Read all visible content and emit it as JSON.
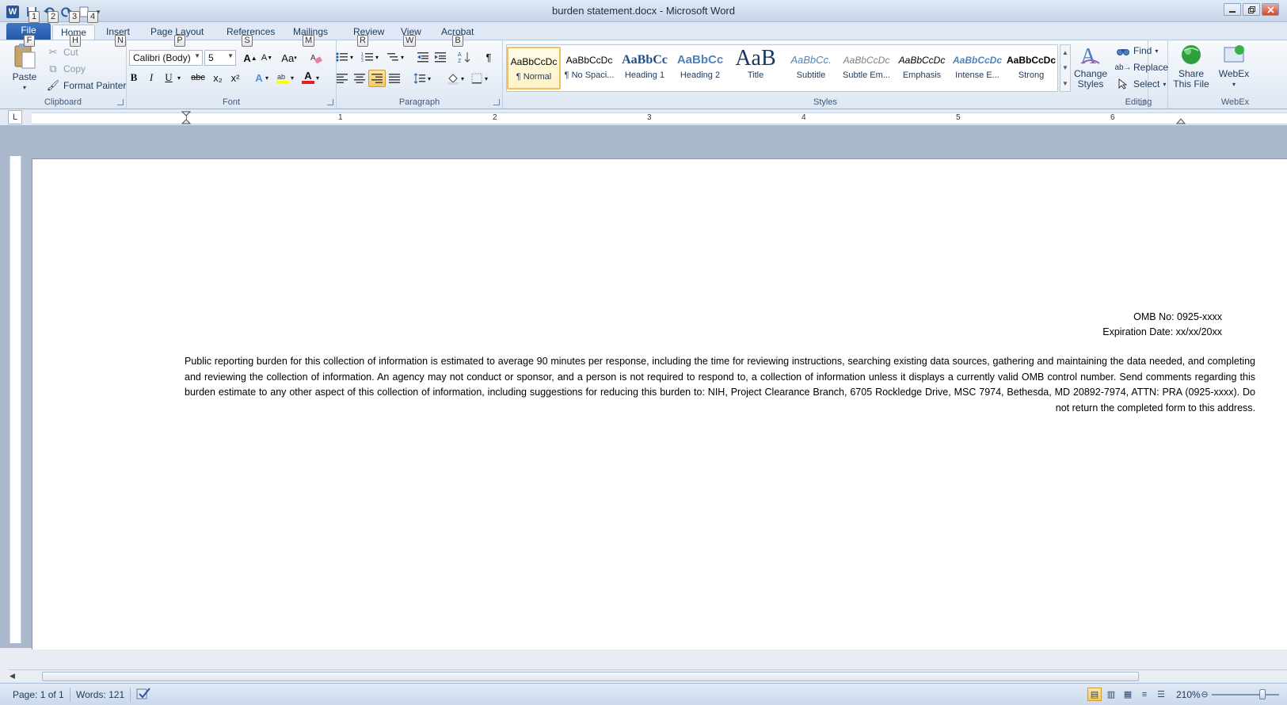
{
  "window": {
    "title": "burden statement.docx - Microsoft Word",
    "qat_keytips": [
      "1",
      "2",
      "3",
      "4"
    ]
  },
  "tabs": [
    {
      "label": "File",
      "keytip": "F"
    },
    {
      "label": "Home",
      "keytip": "H"
    },
    {
      "label": "Insert",
      "keytip": "N"
    },
    {
      "label": "Page Layout",
      "keytip": "P"
    },
    {
      "label": "References",
      "keytip": "S"
    },
    {
      "label": "Mailings",
      "keytip": "M"
    },
    {
      "label": "Review",
      "keytip": "R"
    },
    {
      "label": "View",
      "keytip": "W"
    },
    {
      "label": "Acrobat",
      "keytip": "B"
    }
  ],
  "clipboard": {
    "paste": "Paste",
    "cut": "Cut",
    "copy": "Copy",
    "format_painter": "Format Painter",
    "label": "Clipboard"
  },
  "font": {
    "name": "Calibri (Body)",
    "size": "5",
    "change_case": "Aa",
    "bold": "B",
    "italic": "I",
    "underline": "U",
    "strike": "abc",
    "subscript": "x₂",
    "superscript": "x²",
    "font_color": "A",
    "label": "Font"
  },
  "paragraph": {
    "pilcrow": "¶",
    "label": "Paragraph"
  },
  "styles": {
    "items": [
      {
        "preview": "AaBbCcDc",
        "name": "¶ Normal"
      },
      {
        "preview": "AaBbCcDc",
        "name": "¶ No Spaci..."
      },
      {
        "preview": "AaBbCc",
        "name": "Heading 1"
      },
      {
        "preview": "AaBbCc",
        "name": "Heading 2"
      },
      {
        "preview": "AaB",
        "name": "Title"
      },
      {
        "preview": "AaBbCc.",
        "name": "Subtitle"
      },
      {
        "preview": "AaBbCcDc",
        "name": "Subtle Em..."
      },
      {
        "preview": "AaBbCcDc",
        "name": "Emphasis"
      },
      {
        "preview": "AaBbCcDc",
        "name": "Intense E..."
      },
      {
        "preview": "AaBbCcDc",
        "name": "Strong"
      }
    ],
    "change_styles_line1": "Change",
    "change_styles_line2": "Styles",
    "label": "Styles"
  },
  "editing": {
    "find": "Find",
    "replace": "Replace",
    "select": "Select",
    "label": "Editing"
  },
  "webex": {
    "share_line1": "Share",
    "share_line2": "This File",
    "webex": "WebEx",
    "label": "WebEx"
  },
  "ruler": {
    "numbers": [
      "1",
      "2",
      "3",
      "4",
      "5",
      "6"
    ],
    "tab_selector": "L"
  },
  "document": {
    "omb_no": "OMB No: 0925-xxxx",
    "expiration": "Expiration Date: xx/xx/20xx",
    "paragraph": "Public reporting burden for this collection of information is estimated to average 90 minutes per response, including the time for reviewing instructions, searching existing data sources, gathering and maintaining the data needed, and completing and reviewing the collection of information.  An agency may not conduct or sponsor, and a person is not required to respond to, a collection of information unless it displays a currently valid OMB control number.  Send comments regarding this burden estimate to any other aspect of this collection of information, including suggestions for reducing this burden to: NIH, Project Clearance Branch, 6705 Rockledge Drive, MSC 7974, Bethesda, MD 20892-7974, ATTN: PRA (0925-xxxx). Do not return the completed form to this address."
  },
  "status": {
    "page": "Page: 1 of 1",
    "words": "Words: 121",
    "zoom": "210%"
  },
  "colors": {
    "file_tab": "#2b5797",
    "accent_highlight": "#f8c95d"
  }
}
